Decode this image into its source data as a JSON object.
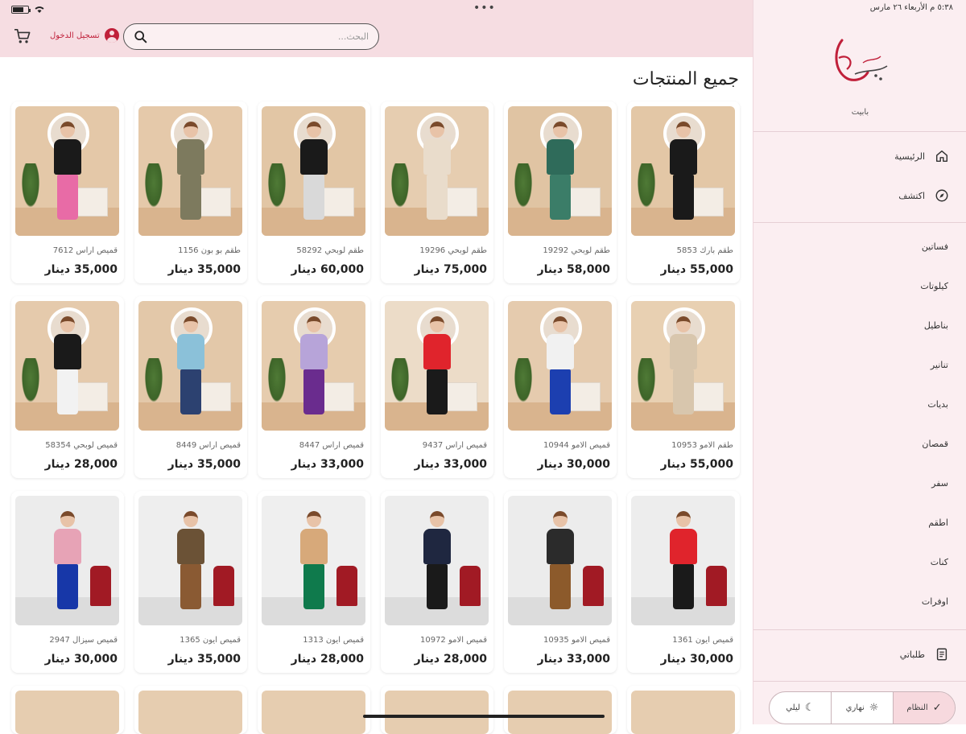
{
  "status": {
    "right_text": "٥:٣٨ م  الأربعاء ٢٦ مارس",
    "dots": "•••"
  },
  "header": {
    "search_placeholder": "البحث...",
    "login_label": "تسجيل الدخول"
  },
  "main": {
    "title": "جميع المنتجات",
    "currency": "دينار"
  },
  "products": [
    {
      "name": "طقم بارك 5853",
      "price": "55,000 دينار",
      "top": "#1a1a1a",
      "bottom": "#1a1a1a",
      "wall": "#e3c7a6"
    },
    {
      "name": "طقم لوبحي 19292",
      "price": "58,000 دينار",
      "top": "#2f6b5a",
      "bottom": "#3b7d68",
      "wall": "#e0c4a3"
    },
    {
      "name": "طقم لوبحي 19296",
      "price": "75,000 دينار",
      "top": "#e9dccb",
      "bottom": "#e9dccb",
      "wall": "#e6cdb0"
    },
    {
      "name": "طقم لوبحي 58292",
      "price": "60,000 دينار",
      "top": "#1a1a1a",
      "bottom": "#d9d9d9",
      "wall": "#e2c6a5"
    },
    {
      "name": "طقم بو بون 1156",
      "price": "35,000 دينار",
      "top": "#7d7a5e",
      "bottom": "#7d7a5e",
      "wall": "#e5c9aa"
    },
    {
      "name": "قميص اراس 7612",
      "price": "35,000 دينار",
      "top": "#1a1a1a",
      "bottom": "#e86ba6",
      "wall": "#e4c8a8"
    },
    {
      "name": "طقم الامو 10953",
      "price": "55,000 دينار",
      "top": "#d8c6ad",
      "bottom": "#d8c6ad",
      "wall": "#e8d0b2"
    },
    {
      "name": "قميص الامو 10944",
      "price": "30,000 دينار",
      "top": "#f1f1f1",
      "bottom": "#1c3fb0",
      "wall": "#e5cbae"
    },
    {
      "name": "قميص اراس 9437",
      "price": "33,000 دينار",
      "top": "#e0242c",
      "bottom": "#1a1a1a",
      "wall": "#ecdcc8"
    },
    {
      "name": "قميص اراس 8447",
      "price": "33,000 دينار",
      "top": "#b7a4d9",
      "bottom": "#6a2c8e",
      "wall": "#e6ccae"
    },
    {
      "name": "قميص اراس 8449",
      "price": "35,000 دينار",
      "top": "#8bc1d9",
      "bottom": "#2c4170",
      "wall": "#e3c8a9"
    },
    {
      "name": "قميص لوبحي 58354",
      "price": "28,000 دينار",
      "top": "#1a1a1a",
      "bottom": "#f2f2f2",
      "wall": "#e5caac"
    },
    {
      "name": "قميص ايون 1361",
      "price": "30,000 دينار",
      "top": "#e0242c",
      "bottom": "#1a1a1a",
      "wall": "#ededed"
    },
    {
      "name": "قميص الامو 10935",
      "price": "33,000 دينار",
      "top": "#2b2b2b",
      "bottom": "#8c5a2b",
      "wall": "#ececec"
    },
    {
      "name": "قميص الامو 10972",
      "price": "28,000 دينار",
      "top": "#1f2740",
      "bottom": "#1a1a1a",
      "wall": "#ededed"
    },
    {
      "name": "قميص ايون 1313",
      "price": "28,000 دينار",
      "top": "#d7a97a",
      "bottom": "#0f7a4c",
      "wall": "#efefef"
    },
    {
      "name": "قميص ايون 1365",
      "price": "35,000 دينار",
      "top": "#6b5236",
      "bottom": "#8a5a33",
      "wall": "#eeeeee"
    },
    {
      "name": "قميص سيزال 2947",
      "price": "30,000 دينار",
      "top": "#e7a3b6",
      "bottom": "#1737a8",
      "wall": "#ececec"
    }
  ],
  "partial_cards": 6,
  "sidebar": {
    "brand_caption": "بابيت",
    "nav": [
      {
        "label": "الرئيسية",
        "icon": "home-icon"
      },
      {
        "label": "اكتشف",
        "icon": "compass-icon"
      }
    ],
    "categories": [
      "فساتين",
      "كيلوتات",
      "بناطيل",
      "تنانير",
      "بديات",
      "قمصان",
      "سفر",
      "اطقم",
      "كنات",
      "اوفرات"
    ],
    "orders_label": "طلباتي",
    "theme": {
      "system": "النظام",
      "light": "نهاري",
      "dark": "ليلي"
    }
  },
  "colors": {
    "header_bg": "#f6dde2",
    "sidebar_bg": "#fbeef1",
    "accent": "#c0203a"
  }
}
